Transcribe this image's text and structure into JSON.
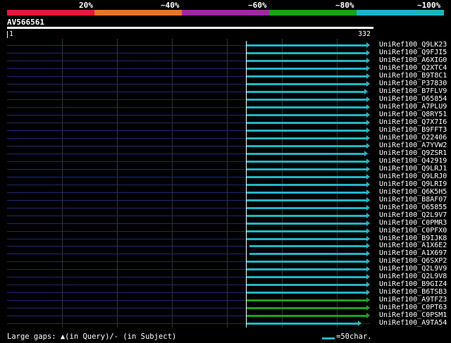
{
  "percent_scale": {
    "labels": [
      "20%",
      "~40%",
      "~60%",
      "~80%",
      "~100%"
    ],
    "colors": [
      "#e8183a",
      "#e6772a",
      "#9a2d9b",
      "#1aa11a",
      "#17b8c4"
    ]
  },
  "query": {
    "name": "AV566561",
    "start": "1",
    "end": "332"
  },
  "hits": [
    {
      "id": "UniRef100_Q9LK23",
      "color": "#1fb6c4"
    },
    {
      "id": "UniRef100_Q9FJI5",
      "color": "#1fb6c4"
    },
    {
      "id": "UniRef100_A6XIG0",
      "color": "#1fb6c4"
    },
    {
      "id": "UniRef100_Q2XTC4",
      "color": "#1fb6c4"
    },
    {
      "id": "UniRef100_B9T8C1",
      "color": "#1fb6c4"
    },
    {
      "id": "UniRef100_P37830",
      "color": "#1fb6c4"
    },
    {
      "id": "UniRef100_B7FLV9",
      "color": "#1fb6c4"
    },
    {
      "id": "UniRef100_O65854",
      "color": "#1fb6c4"
    },
    {
      "id": "UniRef100_A7PLU9",
      "color": "#1fb6c4"
    },
    {
      "id": "UniRef100_Q8RY51",
      "color": "#1fb6c4"
    },
    {
      "id": "UniRef100_Q7X7I6",
      "color": "#1fb6c4"
    },
    {
      "id": "UniRef100_B9FFT3",
      "color": "#1fb6c4"
    },
    {
      "id": "UniRef100_O22406",
      "color": "#1fb6c4"
    },
    {
      "id": "UniRef100_A7YVW2",
      "color": "#1fb6c4"
    },
    {
      "id": "UniRef100_Q9ZSR1",
      "color": "#1fb6c4"
    },
    {
      "id": "UniRef100_Q42919",
      "color": "#1fb6c4"
    },
    {
      "id": "UniRef100_Q9LRJ1",
      "color": "#1fb6c4"
    },
    {
      "id": "UniRef100_Q9LRJ0",
      "color": "#1fb6c4"
    },
    {
      "id": "UniRef100_Q9LRI9",
      "color": "#1fb6c4"
    },
    {
      "id": "UniRef100_Q6K5H5",
      "color": "#1fb6c4"
    },
    {
      "id": "UniRef100_B8AF07",
      "color": "#1fb6c4"
    },
    {
      "id": "UniRef100_O65855",
      "color": "#1fb6c4"
    },
    {
      "id": "UniRef100_Q2L9V7",
      "color": "#1fb6c4"
    },
    {
      "id": "UniRef100_C0PMR3",
      "color": "#1fb6c4"
    },
    {
      "id": "UniRef100_C0PFX0",
      "color": "#1fb6c4"
    },
    {
      "id": "UniRef100_B9IJK8",
      "color": "#1fb6c4"
    },
    {
      "id": "UniRef100_A1X6E2",
      "color": "#1fb6c4"
    },
    {
      "id": "UniRef100_A1X697",
      "color": "#1fb6c4"
    },
    {
      "id": "UniRef100_Q6SXP2",
      "color": "#1fb6c4"
    },
    {
      "id": "UniRef100_Q2L9V9",
      "color": "#1fb6c4"
    },
    {
      "id": "UniRef100_Q2L9V8",
      "color": "#1fb6c4"
    },
    {
      "id": "UniRef100_B9GIZ4",
      "color": "#1fb6c4"
    },
    {
      "id": "UniRef100_B6TSB3",
      "color": "#1fb6c4"
    },
    {
      "id": "UniRef100_A9TFZ3",
      "color": "#1aa11a"
    },
    {
      "id": "UniRef100_C0PT63",
      "color": "#1aa11a"
    },
    {
      "id": "UniRef100_C0PSM1",
      "color": "#1aa11a"
    },
    {
      "id": "UniRef100_A9TA54",
      "color": "#1fb6c4"
    }
  ],
  "footer": {
    "gaps_text": "Large gaps: ▲(in Query)/- (in Subject)",
    "legend_text": "=50char."
  }
}
